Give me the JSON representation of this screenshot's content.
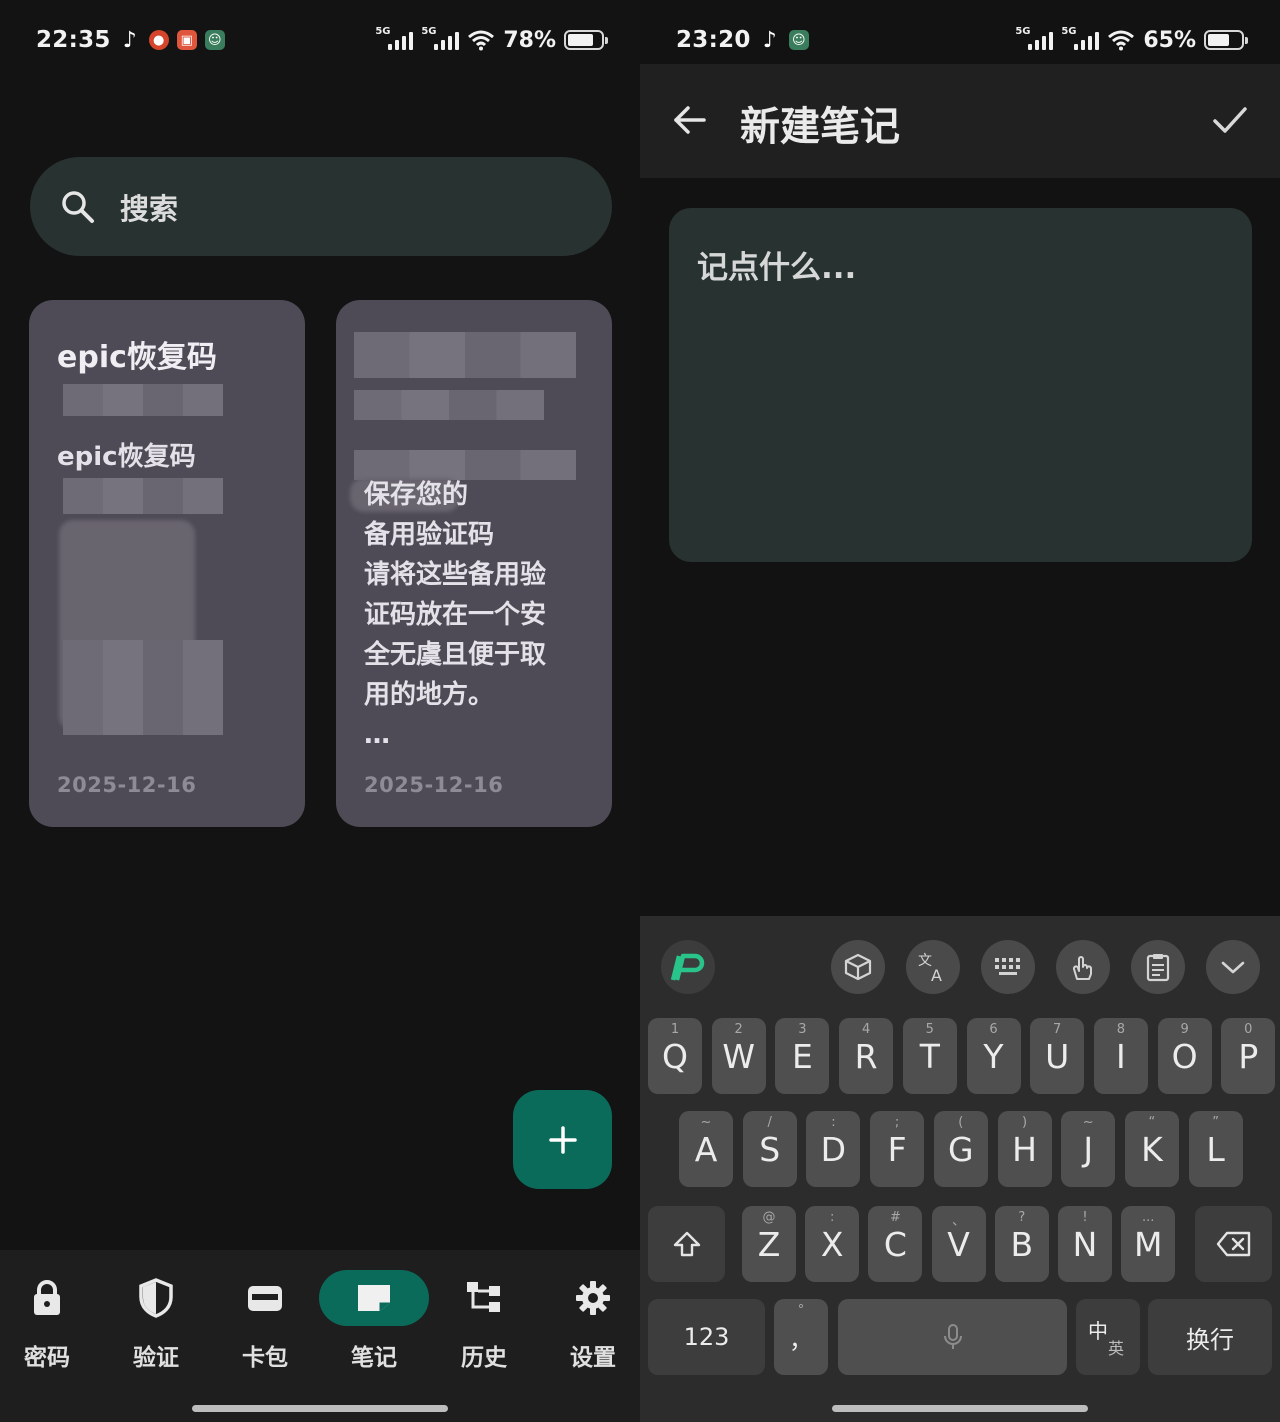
{
  "left": {
    "status": {
      "time": "22:35",
      "network1": "5G",
      "network2": "5G",
      "battery_pct": "78%",
      "battery_level": 0.78
    },
    "search": {
      "label": "搜索"
    },
    "notes": [
      {
        "title": "epic恢复码",
        "line2": "epic恢复码",
        "date": "2025-12-16"
      },
      {
        "body": "保存您的\n备用验证码\n请将这些备用验\n证码放在一个安\n全无虞且便于取\n用的地方。\n…",
        "date": "2025-12-16"
      }
    ],
    "fab": {
      "icon": "plus-icon"
    },
    "nav": [
      {
        "label": "密码",
        "icon": "lock-icon"
      },
      {
        "label": "验证",
        "icon": "shield-icon"
      },
      {
        "label": "卡包",
        "icon": "wallet-icon"
      },
      {
        "label": "笔记",
        "icon": "note-icon",
        "active": true
      },
      {
        "label": "历史",
        "icon": "history-icon"
      },
      {
        "label": "设置",
        "icon": "gear-icon"
      }
    ]
  },
  "right": {
    "status": {
      "time": "23:20",
      "network1": "5G",
      "network2": "5G",
      "battery_pct": "65%",
      "battery_level": 0.65
    },
    "appbar": {
      "title": "新建笔记"
    },
    "editor": {
      "placeholder": "记点什么..."
    },
    "keyboard": {
      "row1": [
        {
          "k": "Q",
          "h": "1"
        },
        {
          "k": "W",
          "h": "2"
        },
        {
          "k": "E",
          "h": "3"
        },
        {
          "k": "R",
          "h": "4"
        },
        {
          "k": "T",
          "h": "5"
        },
        {
          "k": "Y",
          "h": "6"
        },
        {
          "k": "U",
          "h": "7"
        },
        {
          "k": "I",
          "h": "8"
        },
        {
          "k": "O",
          "h": "9"
        },
        {
          "k": "P",
          "h": "0"
        }
      ],
      "row2": [
        {
          "k": "A",
          "h": "~"
        },
        {
          "k": "S",
          "h": "/"
        },
        {
          "k": "D",
          "h": ":"
        },
        {
          "k": "F",
          "h": ";"
        },
        {
          "k": "G",
          "h": "("
        },
        {
          "k": "H",
          "h": ")"
        },
        {
          "k": "J",
          "h": "~"
        },
        {
          "k": "K",
          "h": "“"
        },
        {
          "k": "L",
          "h": "”"
        }
      ],
      "row3": [
        {
          "k": "Z",
          "h": "@"
        },
        {
          "k": "X",
          "h": ":"
        },
        {
          "k": "C",
          "h": "#"
        },
        {
          "k": "V",
          "h": "、"
        },
        {
          "k": "B",
          "h": "?"
        },
        {
          "k": "N",
          "h": "!"
        },
        {
          "k": "M",
          "h": "..."
        }
      ],
      "num_key": "123",
      "comma_key": "，",
      "comma_hint": "°",
      "lang_key_top": "中",
      "lang_key_bottom": "英",
      "enter_key": "换行"
    }
  }
}
